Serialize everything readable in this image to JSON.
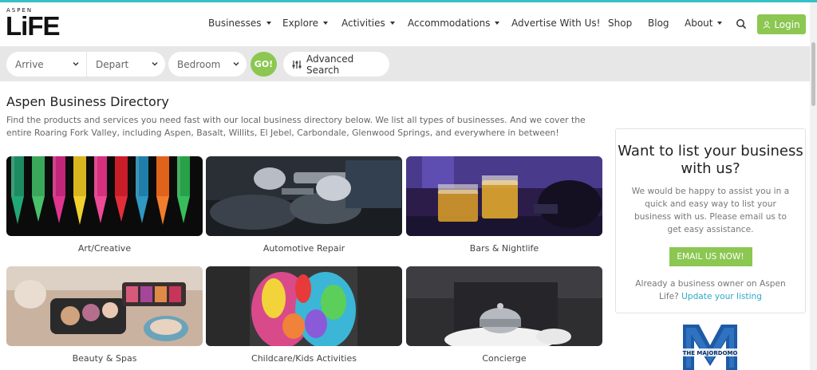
{
  "header": {
    "logo": {
      "small": "ASPEN",
      "big": "LiFE"
    },
    "nav": [
      {
        "label": "Businesses",
        "dropdown": true
      },
      {
        "label": "Explore",
        "dropdown": true
      },
      {
        "label": "Activities",
        "dropdown": true
      },
      {
        "label": "Accommodations",
        "dropdown": true
      },
      {
        "label": "Advertise With Us!",
        "dropdown": false
      },
      {
        "label": "Shop",
        "dropdown": false
      },
      {
        "label": "Blog",
        "dropdown": false
      },
      {
        "label": "About",
        "dropdown": true
      }
    ],
    "search_icon": "search-icon",
    "login_label": "Login"
  },
  "search": {
    "arrive_placeholder": "Arrive",
    "depart_placeholder": "Depart",
    "bedroom_placeholder": "Bedroom",
    "go_label": "GO!",
    "advanced_label": "Advanced Search"
  },
  "main": {
    "title": "Aspen Business Directory",
    "intro": "Find the products and services you need fast with our local business directory below. We list all types of businesses. And we cover the entire Roaring Fork Valley, including Aspen, Basalt, Willits, El Jebel, Carbondale, Glenwood Springs, and everywhere in between!",
    "categories": [
      {
        "label": "Art/Creative"
      },
      {
        "label": "Automotive Repair"
      },
      {
        "label": "Bars & Nightlife"
      },
      {
        "label": "Beauty & Spas"
      },
      {
        "label": "Childcare/Kids Activities"
      },
      {
        "label": "Concierge"
      }
    ]
  },
  "sidebar": {
    "heading": "Want to list your business with us?",
    "body": "We would be happy to assist you in a quick and easy way to list your business with us. Please email us to get easy assistance.",
    "email_button": "EMAIL US NOW!",
    "owner_text": "Already a business owner on Aspen Life?",
    "owner_link": "Update your listing",
    "badge_text": "THE MAJORDOMO"
  },
  "colors": {
    "accent_green": "#8bc751",
    "link_blue": "#2fa8c9",
    "top_line": "#38c0c6"
  }
}
